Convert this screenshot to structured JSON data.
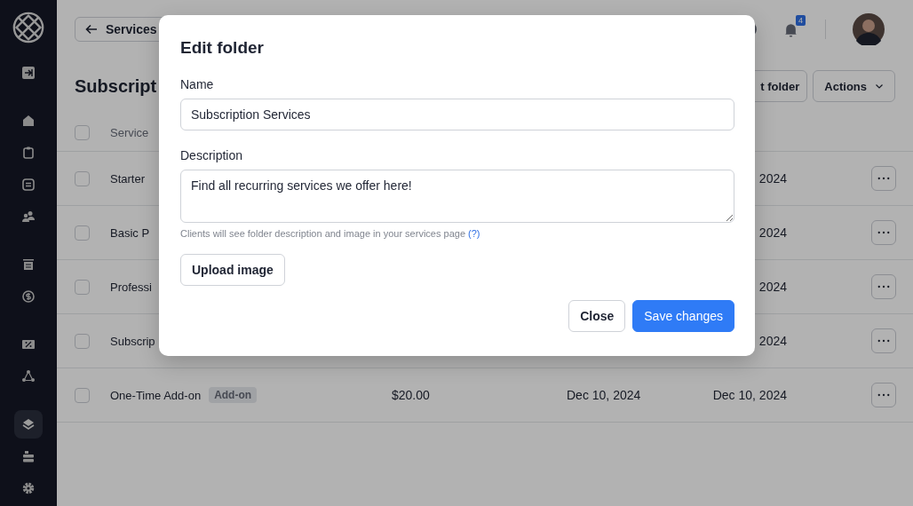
{
  "sidebar": {
    "items": [
      {
        "selected": false
      },
      {
        "selected": false
      },
      {
        "selected": false
      },
      {
        "selected": false
      },
      {
        "selected": false
      },
      {
        "selected": false
      },
      {
        "selected": false
      },
      {
        "selected": false
      },
      {
        "selected": false
      },
      {
        "selected": true
      },
      {
        "selected": false
      },
      {
        "selected": false
      }
    ]
  },
  "topbar": {
    "back_button": "Services",
    "notification_count": "4"
  },
  "page": {
    "title": "Subscript",
    "buttons": [
      "t folder",
      "Actions"
    ]
  },
  "table": {
    "all_checked": false,
    "columns": [
      "Service"
    ],
    "rows": [
      {
        "checked": false,
        "name": "Starter",
        "last_date": "2024"
      },
      {
        "checked": false,
        "name": "Basic P",
        "last_date": "2024"
      },
      {
        "checked": false,
        "name": "Professi",
        "last_date": "2024"
      },
      {
        "checked": false,
        "name": "Subscrip",
        "last_date": "2024"
      },
      {
        "checked": false,
        "name": "One-Time Add-on",
        "badge": "Add-on",
        "price": "$20.00",
        "date": "Dec 10, 2024",
        "last_date": "Dec 10, 2024"
      }
    ]
  },
  "modal": {
    "title": "Edit folder",
    "name_label": "Name",
    "name_value": "Subscription Services",
    "description_label": "Description",
    "description_value": "Find all recurring services we offer here!",
    "hint": "Clients will see folder description and image in your services page",
    "hint_link": "(?)",
    "upload_button": "Upload image",
    "close_button": "Close",
    "save_button": "Save changes"
  }
}
